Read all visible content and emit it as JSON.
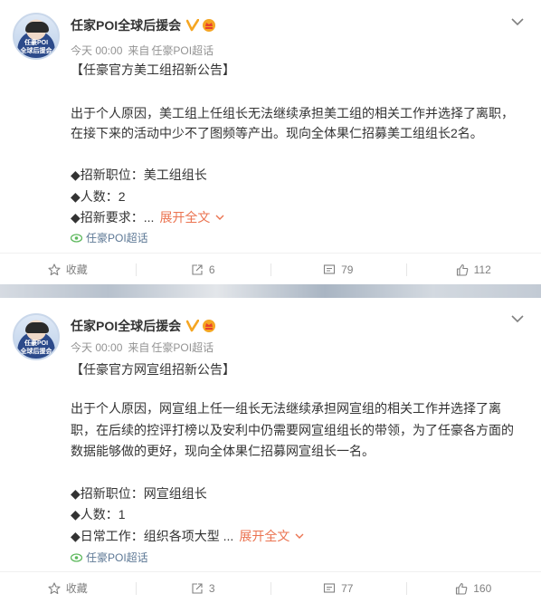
{
  "posts": [
    {
      "author": "任家POI全球后援会",
      "time": "今天 00:00",
      "source_prefix": "来自",
      "source": "任豪POI超话",
      "avatar_text": [
        "任豪POI",
        "全球后援会"
      ],
      "title": "【任豪官方美工组招新公告】",
      "paragraphs": [
        "出于个人原因，美工组上任组长无法继续承担美工组的相关工作并选择了离职，",
        "在接下来的活动中少不了图频等产出。现向全体果仁招募美工组组长2名。"
      ],
      "items": [
        "◆招新职位：美工组组长",
        "◆人数：2",
        "◆招新要求：..."
      ],
      "expand_label": "展开全文",
      "topic": "任豪POI超话",
      "actions": {
        "favorite": "收藏",
        "repost": "6",
        "comment": "79",
        "like": "112"
      }
    },
    {
      "author": "任家POI全球后援会",
      "time": "今天 00:00",
      "source_prefix": "来自",
      "source": "任豪POI超话",
      "avatar_text": [
        "任豪POI",
        "全球后援会"
      ],
      "title": "【任豪官方网宣组招新公告】",
      "paragraphs": [
        "出于个人原因，网宣组上任一组长无法继续承担网宣组的相关工作并选择了离",
        "职，在后续的控评打榜以及安利中仍需要网宣组组长的带领，为了任豪各方面的",
        "数据能够做的更好，现向全体果仁招募网宣组长一名。"
      ],
      "items": [
        "◆招新职位：网宣组组长",
        "◆人数：1",
        "◆日常工作：组织各项大型 ..."
      ],
      "expand_label": "展开全文",
      "topic": "任豪POI超话",
      "actions": {
        "favorite": "收藏",
        "repost": "3",
        "comment": "77",
        "like": "160"
      }
    }
  ],
  "colors": {
    "accent": "#eb7350",
    "verified": "#f5a623",
    "topic": "#5d7895",
    "meta": "#939393"
  },
  "icons": {
    "verified": "verified-v-icon",
    "badge": "member-badge-icon",
    "menu": "chevron-down-icon",
    "topic": "super-topic-icon",
    "favorite": "star-icon",
    "repost": "repost-icon",
    "comment": "comment-icon",
    "like": "thumbs-up-icon"
  }
}
